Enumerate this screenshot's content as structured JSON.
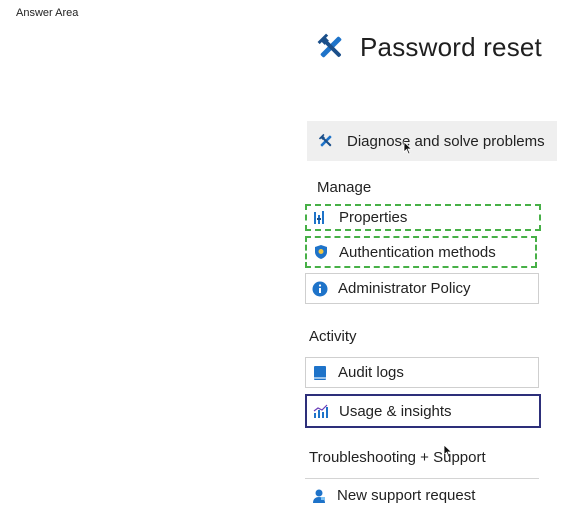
{
  "answer_area_label": "Answer Area",
  "header": {
    "title": "Password reset",
    "icon": "tools-icon"
  },
  "diagnose": {
    "label": "Diagnose and solve problems",
    "icon": "tools-icon"
  },
  "sections": {
    "manage": "Manage",
    "activity": "Activity",
    "troubleshooting": "Troubleshooting + Support"
  },
  "menu": {
    "properties": {
      "label": "Properties",
      "icon": "properties-icon"
    },
    "authentication_methods": {
      "label": "Authentication methods",
      "icon": "shield-icon"
    },
    "administrator_policy": {
      "label": "Administrator Policy",
      "icon": "info-icon"
    },
    "audit_logs": {
      "label": "Audit logs",
      "icon": "book-icon"
    },
    "usage_insights": {
      "label": "Usage & insights",
      "icon": "chart-icon"
    },
    "new_support_request": {
      "label": "New support request",
      "icon": "person-icon"
    }
  },
  "colors": {
    "accent_blue": "#1e73c9",
    "selection_green": "#47b047",
    "selection_navy": "#2d2f7a",
    "button_bg": "#efefef"
  }
}
